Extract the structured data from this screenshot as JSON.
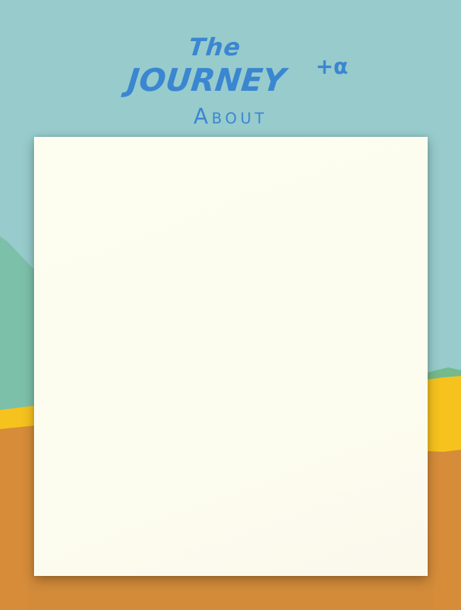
{
  "logo": {
    "line1": "The",
    "line2": "JOURNEY",
    "suffix": "+α"
  },
  "page_title": "About",
  "content_panel": {
    "text": ""
  },
  "colors": {
    "sky": "#97cbcc",
    "hill": "#7dc0aa",
    "sand": "#f6c21e",
    "ground": "#d68c39",
    "title": "#3b86d1",
    "panel": "#fdfeef"
  }
}
